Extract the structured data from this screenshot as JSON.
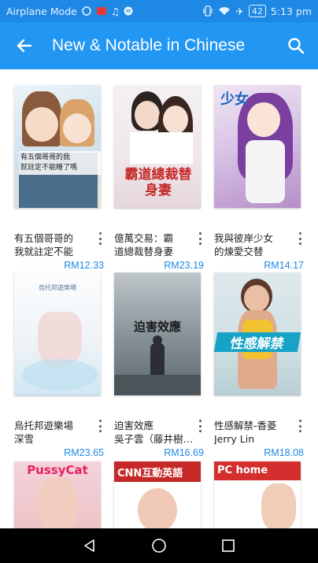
{
  "status_bar": {
    "carrier": "Airplane Mode",
    "battery": "42",
    "time": "5:13 pm"
  },
  "app_bar": {
    "title": "New & Notable in Chinese",
    "back_icon": "arrow-left-icon",
    "search_icon": "search-icon"
  },
  "accent_color": "#2196f3",
  "price_color": "#1e88e5",
  "books": [
    {
      "title_line1": "有五個哥哥的",
      "title_line2": "我就註定不能",
      "price": "RM12.33",
      "cover_text": "有五個哥哥的我\n就註定不能睡了嗎"
    },
    {
      "title_line1": "億萬交易：霸",
      "title_line2": "道總裁替身妻",
      "price": "RM23.19",
      "cover_text": "霸道總裁替身妻"
    },
    {
      "title_line1": "我與彼岸少女",
      "title_line2": "的煉愛交替",
      "price": "RM14.17",
      "cover_text": "少女"
    },
    {
      "title_line1": "烏托邦遊樂場",
      "title_line2": "深雪",
      "price": "RM23.65",
      "cover_text": "烏托邦遊樂場"
    },
    {
      "title_line1": "迫害效應",
      "title_line2": "吳子雲（藤井樹…",
      "price": "RM16.69",
      "cover_text": "迫害效應"
    },
    {
      "title_line1": "性感解禁-香菱",
      "title_line2": "Jerry Lin",
      "price": "RM18.08",
      "cover_text": "性感解禁"
    },
    {
      "cover_text": "PussyCat"
    },
    {
      "cover_text": "CNN互動英語"
    },
    {
      "cover_text": "PC home"
    }
  ],
  "nav_bar": {
    "back": "triangle-back-icon",
    "home": "circle-home-icon",
    "recents": "square-recents-icon"
  }
}
